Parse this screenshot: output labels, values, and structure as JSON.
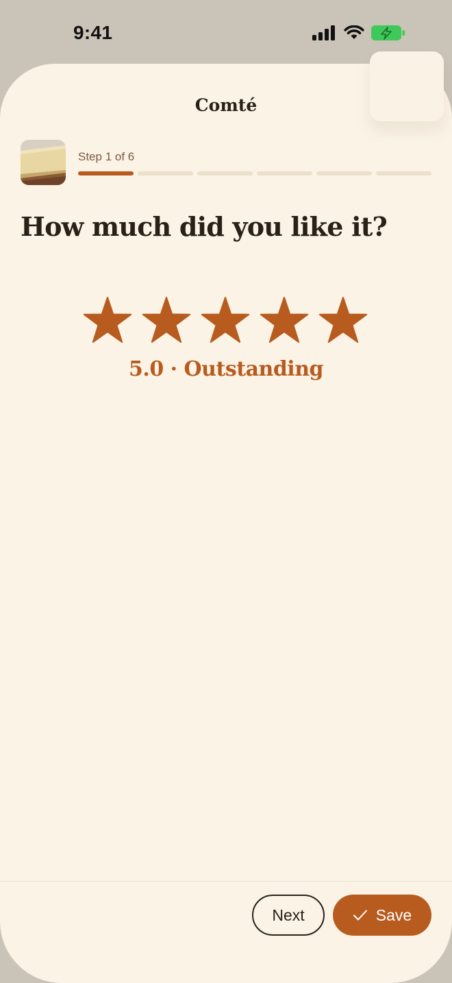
{
  "status_bar": {
    "time": "9:41"
  },
  "sheet": {
    "title": "Comté",
    "step_label": "Step 1 of 6",
    "progress": {
      "current": 1,
      "total": 6
    },
    "question": "How much did you like it?",
    "rating": {
      "value": 5,
      "max": 5,
      "label": "5.0 · Outstanding"
    }
  },
  "footer": {
    "next_label": "Next",
    "save_label": "Save"
  },
  "colors": {
    "accent": "#b85b1e",
    "background": "#fbf3e6",
    "text": "#2a2018",
    "battery": "#3ec95a"
  }
}
